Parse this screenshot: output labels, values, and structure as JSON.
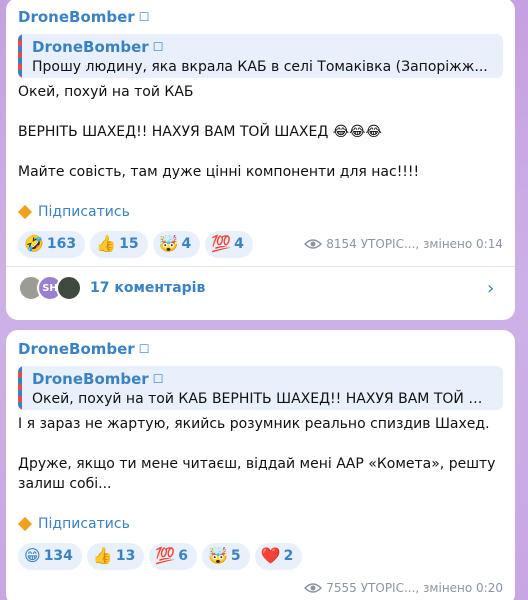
{
  "posts": [
    {
      "author": "DroneBomber",
      "author_badge": "☐",
      "reply": {
        "author": "DroneBomber",
        "author_badge": "☐",
        "text": "Прошу людину, яка вкрала КАБ в селі Томаківка (Запоріжж..."
      },
      "lines": [
        "Окей, похуй на той КАБ",
        "ВЕРНІТЬ ШАХЕД!! НАХУЯ ВАМ ТОЙ ШАХЕД 😂😂😂",
        "Майте совість, там дуже цінні компоненти для нас!!!!"
      ],
      "subscribe_label": "Підписатись",
      "reactions": [
        {
          "emoji": "🤣",
          "count": "163"
        },
        {
          "emoji": "👍",
          "count": "15"
        },
        {
          "emoji": "🤯",
          "count": "4"
        },
        {
          "emoji": "💯",
          "count": "4"
        }
      ],
      "views": "8154",
      "meta": "УТОРІС..., змінено 0:14",
      "comments": {
        "avatar_initials": [
          "",
          "SH",
          ""
        ],
        "label": "17 коментарів"
      }
    },
    {
      "author": "DroneBomber",
      "author_badge": "☐",
      "reply": {
        "author": "DroneBomber",
        "author_badge": "☐",
        "text": "Окей, похуй на той КАБ  ВЕРНІТЬ ШАХЕД!! НАХУЯ ВАМ ТОЙ Ш..."
      },
      "lines": [
        "І я зараз не жартую, якийсь розумник реально спиздив Шахед.",
        "Друже, якщо ти мене читаєш, віддай мені ААР «Комета», решту залиш собі..."
      ],
      "subscribe_label": "Підписатись",
      "reactions": [
        {
          "emoji": "😁",
          "count": "134"
        },
        {
          "emoji": "👍",
          "count": "13"
        },
        {
          "emoji": "💯",
          "count": "6"
        },
        {
          "emoji": "🤯",
          "count": "5"
        },
        {
          "emoji": "❤️",
          "count": "2"
        }
      ],
      "views": "7555",
      "meta": "УТОРІС..., змінено 0:20"
    }
  ],
  "colors": {
    "accent": "#3a82c4",
    "background": "#c9a8e3",
    "reaction_bg": "#e8f1fb",
    "subscribe_icon": "#f0a21d"
  }
}
